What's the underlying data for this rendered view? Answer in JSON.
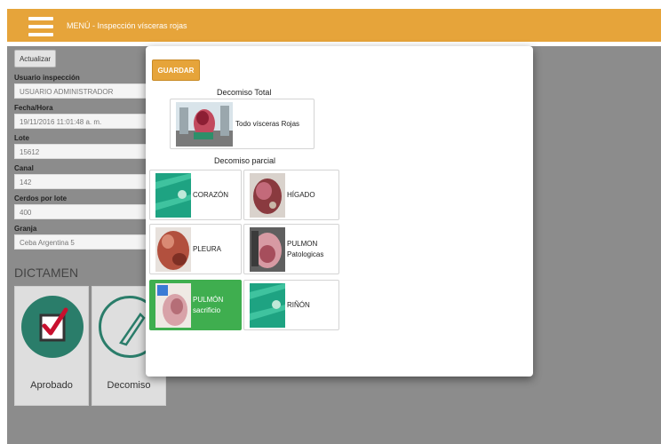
{
  "header": {
    "title": "MENÚ - Inspección vísceras rojas"
  },
  "form": {
    "actualizar_label": "Actualizar",
    "usuario_label": "Usuario inspección",
    "usuario_value": "USUARIO ADMINISTRADOR",
    "fecha_label": "Fecha/Hora",
    "fecha_value": "19/11/2016 11:01:48 a. m.",
    "lote_label": "Lote",
    "lote_value": "15612",
    "canal_label": "Canal",
    "canal_value": "142",
    "cerdos_label": "Cerdos por lote",
    "cerdos_value": "400",
    "granja_label": "Granja",
    "granja_value": "Ceba Argentina 5"
  },
  "dictamen": {
    "title": "DICTAMEN",
    "aprobado_label": "Aprobado",
    "decomiso_label": "Decomiso"
  },
  "modal": {
    "guardar_label": "GUARDAR",
    "total_title": "Decomiso Total",
    "total_option": "Todo vísceras Rojas",
    "parcial_title": "Decomiso parcial",
    "options": [
      {
        "line1": "CORAZÓN",
        "line2": "",
        "selected": false
      },
      {
        "line1": "HÍGADO",
        "line2": "",
        "selected": false
      },
      {
        "line1": "PLEURA",
        "line2": "",
        "selected": false
      },
      {
        "line1": "PULMON",
        "line2": "Patologicas",
        "selected": false
      },
      {
        "line1": "PULMÓN",
        "line2": "sacrificio",
        "selected": true
      },
      {
        "line1": "RIÑÓN",
        "line2": "",
        "selected": false
      }
    ]
  },
  "colors": {
    "accent": "#e6a43a",
    "overlay": "#8c8c8c",
    "selected": "#3fae4f",
    "dictamen_circle": "#2a7d6a"
  }
}
